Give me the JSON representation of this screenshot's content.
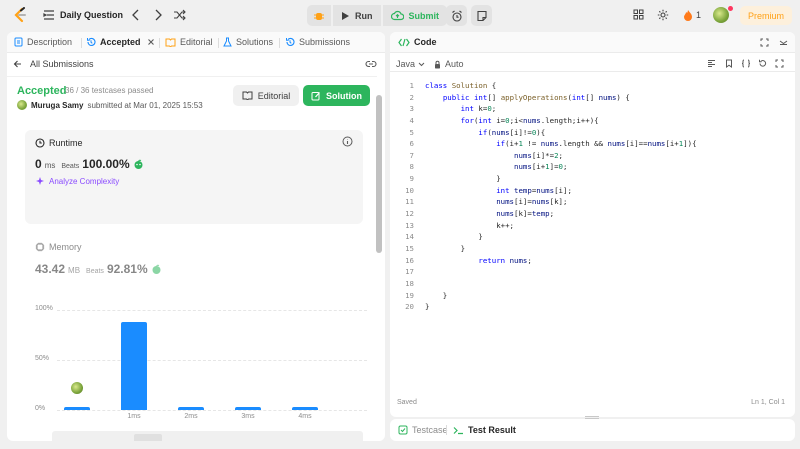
{
  "topbar": {
    "title": "Daily Question",
    "run_label": "Run",
    "submit_label": "Submit",
    "streak_count": "1",
    "premium_label": "Premium",
    "accent": "#ffa116"
  },
  "left_tabs": [
    {
      "label": "Description",
      "icon": "description-icon"
    },
    {
      "label": "Accepted",
      "icon": "history-icon"
    },
    {
      "label": "Editorial",
      "icon": "book-icon"
    },
    {
      "label": "Solutions",
      "icon": "flask-icon"
    },
    {
      "label": "Submissions",
      "icon": "history-icon"
    }
  ],
  "submission": {
    "back_label": "All Submissions",
    "status": "Accepted",
    "testcases": "36 / 36 testcases passed",
    "user": "Muruga Samy",
    "submitted_text": "submitted at Mar 01, 2025 15:53",
    "editorial_btn": "Editorial",
    "solution_btn": "Solution",
    "status_color": "#2db55d"
  },
  "runtime": {
    "title": "Runtime",
    "value": "0",
    "unit": "ms",
    "beats_label": "Beats",
    "beats_value": "100.00%",
    "analyze_label": "Analyze Complexity"
  },
  "memory": {
    "title": "Memory",
    "value": "43.42",
    "unit": "MB",
    "beats_label": "Beats",
    "beats_value": "92.81%"
  },
  "chart_data": {
    "type": "bar",
    "categories": [
      "0ms",
      "1ms",
      "2ms",
      "3ms",
      "4ms"
    ],
    "x_tick_labels": [
      "",
      "1ms",
      "2ms",
      "3ms",
      "4ms"
    ],
    "values": [
      3,
      88,
      3,
      3,
      3
    ],
    "y_ticks": [
      "100%",
      "50%",
      "0%"
    ],
    "ylim": [
      0,
      100
    ],
    "highlight_index": 0,
    "color": "#1a8cff",
    "overview_labels": [
      "",
      "1ms",
      "2ms",
      "3ms",
      "4ms"
    ]
  },
  "code_panel": {
    "title": "Code",
    "language": "Java",
    "auto_label": "Auto",
    "saved_label": "Saved",
    "cursor_pos": "Ln 1, Col 1",
    "lines": [
      "class Solution {",
      "    public int[] applyOperations(int[] nums) {",
      "        int k=0;",
      "        for(int i=0;i<nums.length;i++){",
      "            if(nums[i]!=0){",
      "                if(i+1 != nums.length && nums[i]==nums[i+1]){",
      "                    nums[i]*=2;",
      "                    nums[i+1]=0;",
      "                }",
      "                int temp=nums[i];",
      "                nums[i]=nums[k];",
      "                nums[k]=temp;",
      "                k++;",
      "            }",
      "        }",
      "            return nums;",
      "",
      "",
      "    }",
      "}"
    ]
  },
  "bottom_panel": {
    "testcase_label": "Testcase",
    "result_label": "Test Result"
  }
}
